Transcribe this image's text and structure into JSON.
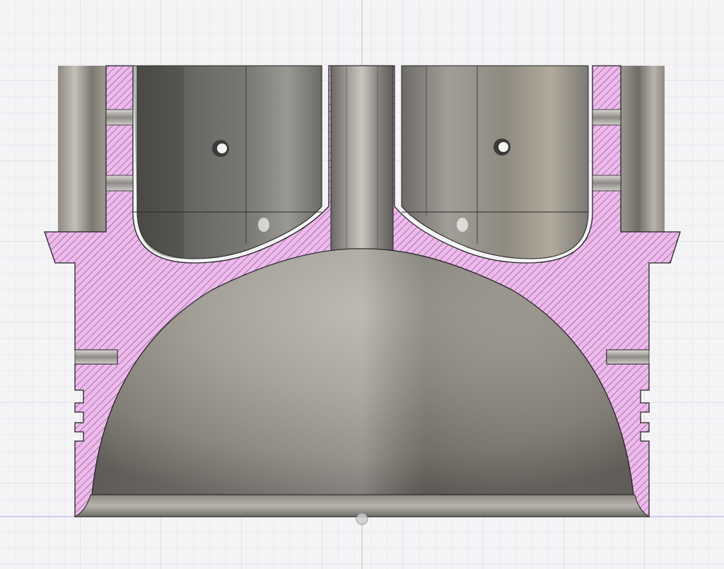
{
  "view": {
    "kind": "cad-section-view",
    "background_color": "#f4f4f6",
    "grid_minor_color": "#e2e2e8",
    "grid_major_color": "#cfcfd8",
    "axis_vertical_color": "#9fd39f",
    "axis_horizontal_color": "#a9a9e6"
  },
  "section": {
    "hatch_fill_color": "#efb9ee",
    "hatch_line_color": "#5a4a5a",
    "outline_color": "#222222"
  },
  "surfaces": {
    "metal_light": "#bdbab3",
    "metal_mid": "#8f8c86",
    "metal_dark": "#5d5b57"
  }
}
